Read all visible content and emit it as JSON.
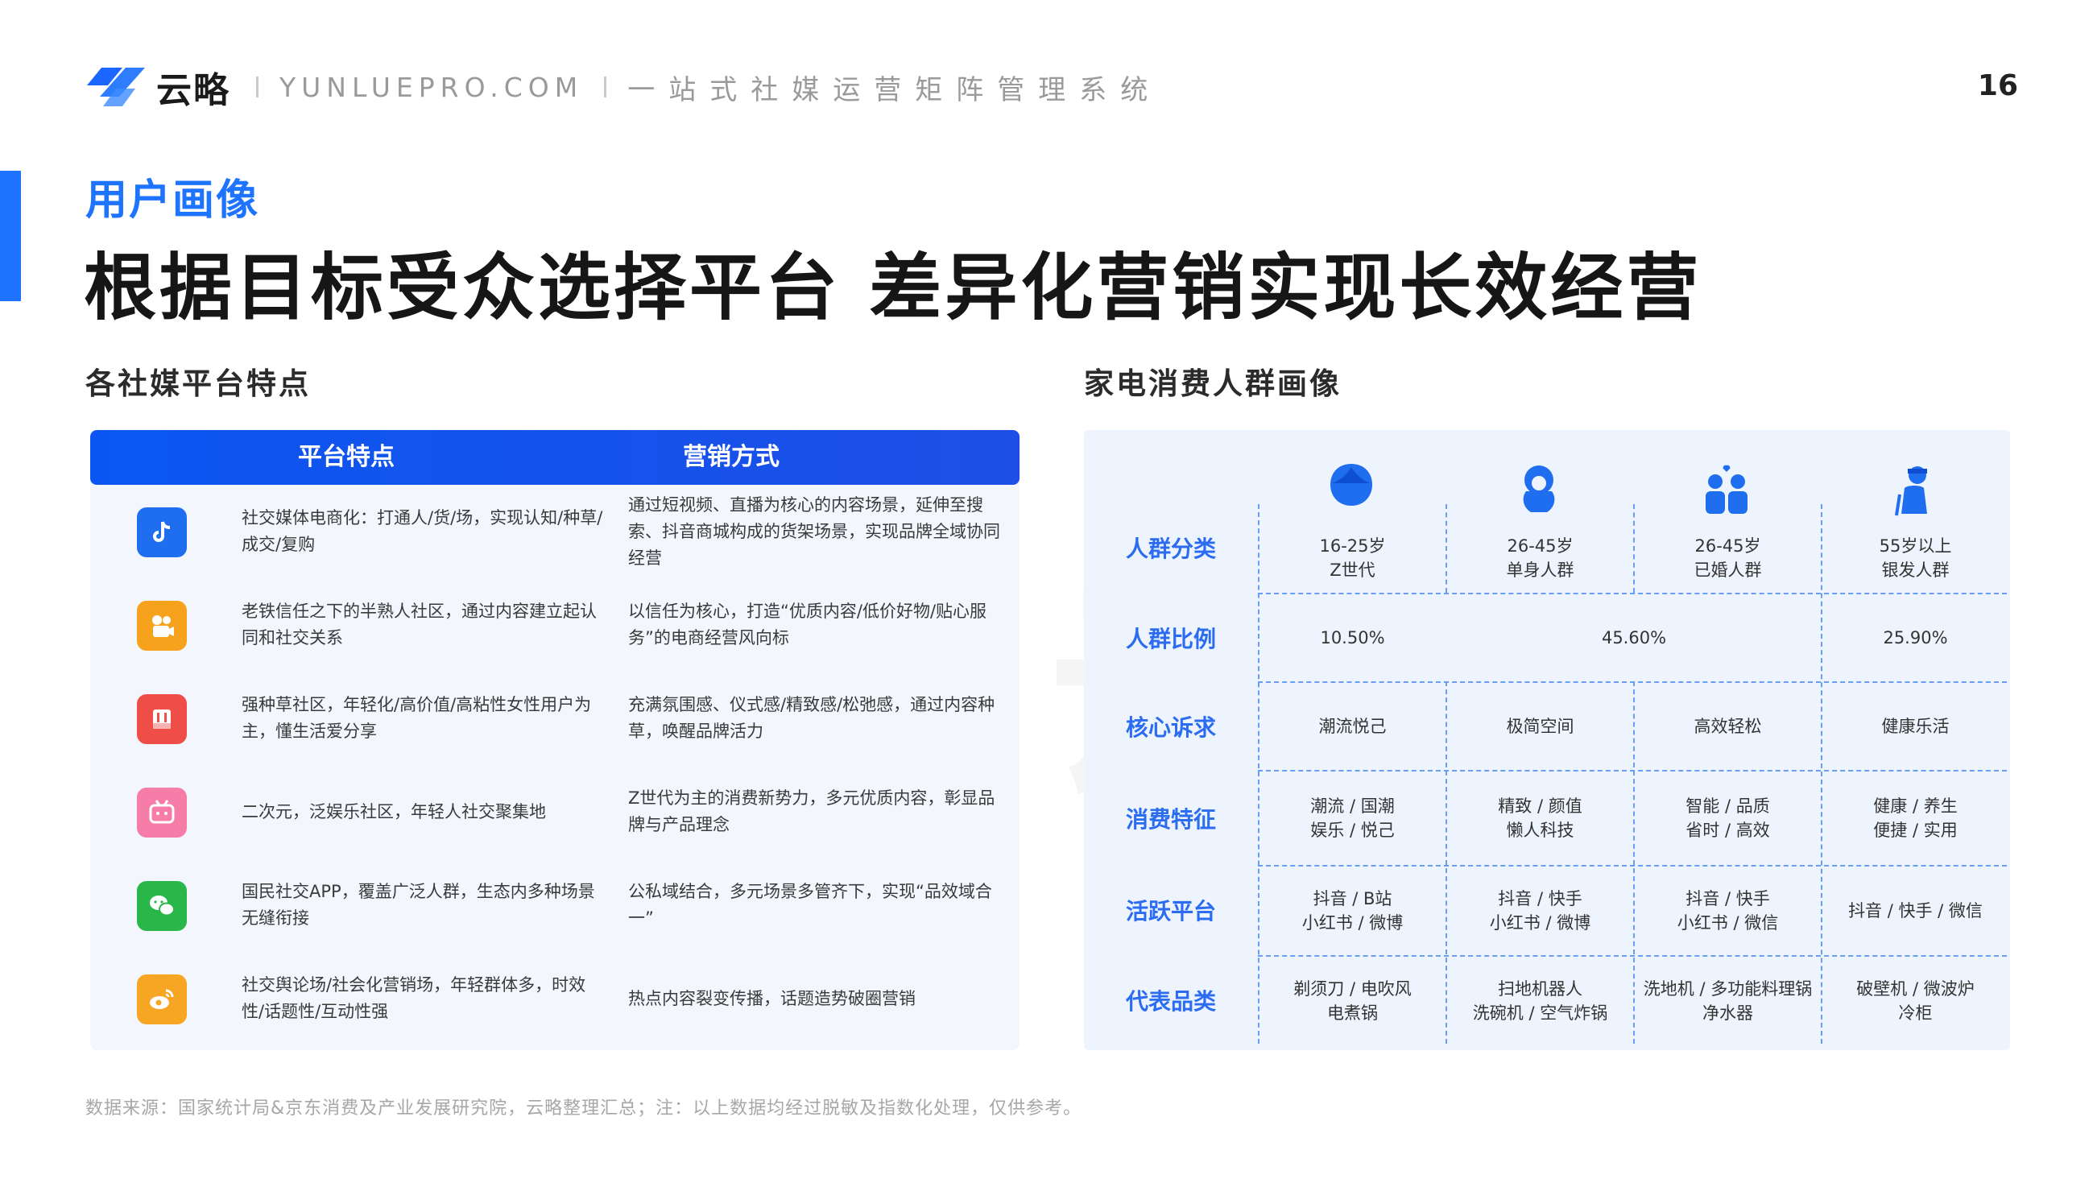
{
  "header": {
    "brand": "云略",
    "domain": "YUNLUEPRO.COM",
    "slogan": "一站式社媒运营矩阵管理系统",
    "page_number": "16"
  },
  "section_label": "用户画像",
  "title": "根据目标受众选择平台  差异化营销实现长效经营",
  "left_subtitle": "各社媒平台特点",
  "right_subtitle": "家电消费人群画像",
  "platform_table": {
    "headers": [
      "平台特点",
      "营销方式"
    ],
    "rows": [
      {
        "icon": "douyin-icon",
        "color": "#1f6ef0",
        "feature": "社交媒体电商化：打通人/货/场，实现认知/种草/成交/复购",
        "marketing": "通过短视频、直播为核心的内容场景，延伸至搜索、抖音商城构成的货架场景，实现品牌全域协同经营"
      },
      {
        "icon": "kuaishou-icon",
        "color": "#f7a21c",
        "feature": "老铁信任之下的半熟人社区，通过内容建立起认同和社交关系",
        "marketing": "以信任为核心，打造“优质内容/低价好物/贴心服务”的电商经营风向标"
      },
      {
        "icon": "xiaohongshu-icon",
        "color": "#ef4d48",
        "feature": "强种草社区，年轻化/高价值/高粘性女性用户为主，懂生活爱分享",
        "marketing": "充满氛围感、仪式感/精致感/松弛感，通过内容种草，唤醒品牌活力"
      },
      {
        "icon": "bilibili-icon",
        "color": "#f57da8",
        "feature": "二次元，泛娱乐社区，年轻人社交聚集地",
        "marketing": "Z世代为主的消费新势力，多元优质内容，彰显品牌与产品理念"
      },
      {
        "icon": "wechat-icon",
        "color": "#2ab74a",
        "feature": "国民社交APP，覆盖广泛人群，生态内多种场景无缝衔接",
        "marketing": "公私域结合，多元场景多管齐下，实现“品效域合一”"
      },
      {
        "icon": "weibo-icon",
        "color": "#f6a623",
        "feature": "社交舆论场/社会化营销场，年轻群体多，时效性/话题性/互动性强",
        "marketing": "热点内容裂变传播，话题造势破圈营销"
      }
    ]
  },
  "persona_table": {
    "row_labels": [
      "人群分类",
      "人群比例",
      "核心诉求",
      "消费特征",
      "活跃平台",
      "代表品类"
    ],
    "groups": [
      {
        "icon": "young-person-icon",
        "age": "16-25岁",
        "name": "Z世代",
        "appeal": "潮流悦己",
        "traits": [
          "潮流 / 国潮",
          "娱乐 / 悦己"
        ],
        "platforms": [
          "抖音 / B站",
          "小红书 / 微博"
        ],
        "categories": [
          "剃须刀 / 电吹风",
          "电煮锅"
        ]
      },
      {
        "icon": "single-person-icon",
        "age": "26-45岁",
        "name": "单身人群",
        "appeal": "极简空间",
        "traits": [
          "精致 / 颜值",
          "懒人科技"
        ],
        "platforms": [
          "抖音 / 快手",
          "小红书 / 微博"
        ],
        "categories": [
          "扫地机器人",
          "洗碗机 / 空气炸锅"
        ]
      },
      {
        "icon": "couple-icon",
        "age": "26-45岁",
        "name": "已婚人群",
        "appeal": "高效轻松",
        "traits": [
          "智能 / 品质",
          "省时 / 高效"
        ],
        "platforms": [
          "抖音 / 快手",
          "小红书 / 微信"
        ],
        "categories": [
          "洗地机 / 多功能料理锅",
          "净水器"
        ]
      },
      {
        "icon": "elderly-person-icon",
        "age": "55岁以上",
        "name": "银发人群",
        "appeal": "健康乐活",
        "traits": [
          "健康 / 养生",
          "便捷 / 实用"
        ],
        "platforms": [
          "抖音 / 快手 / 微信"
        ],
        "categories": [
          "破壁机 / 微波炉",
          "冷柜"
        ]
      }
    ],
    "ratios": {
      "z_gen": "10.50%",
      "middle": "45.60%",
      "silver": "25.90%"
    }
  },
  "footer": "数据来源：国家统计局&京东消费及产业发展研究院，云略整理汇总；注：以上数据均经过脱敏及指数化处理，仅供参考。",
  "colors": {
    "accent": "#1f74ff",
    "table_header": "#0b56f2",
    "label_blue": "#2b6cf0"
  }
}
